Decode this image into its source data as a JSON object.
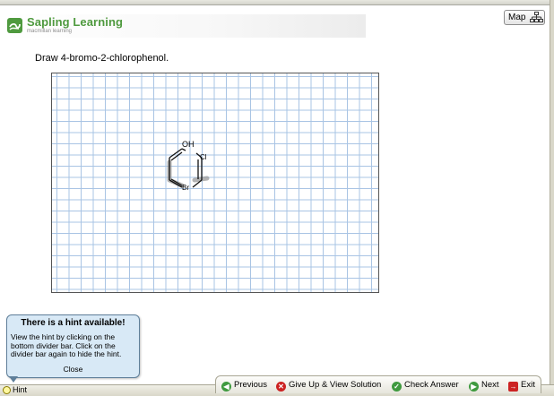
{
  "brand": {
    "name": "Sapling Learning",
    "subtitle": "macmillan learning",
    "icon": "sapling-logo-icon"
  },
  "map_button": {
    "label": "Map",
    "icon": "sitemap-icon"
  },
  "question": {
    "text": "Draw 4-bromo-2-chlorophenol."
  },
  "molecule": {
    "labels": {
      "oh": "OH",
      "cl": "Cl",
      "br": "Br"
    }
  },
  "hint_popup": {
    "title": "There is a hint available!",
    "body": "View the hint by clicking on the bottom divider bar. Click on the divider bar again to hide the hint.",
    "close_label": "Close"
  },
  "hint_tab": {
    "label": "Hint",
    "icon": "lightbulb-icon"
  },
  "nav": {
    "previous": "Previous",
    "give_up": "Give Up & View Solution",
    "check": "Check Answer",
    "next": "Next",
    "exit": "Exit"
  },
  "colors": {
    "brand_green": "#4f9a3f",
    "grid_blue": "#a9c4e4",
    "hint_bg": "#d8e9f6",
    "accent_red": "#cc2222"
  }
}
